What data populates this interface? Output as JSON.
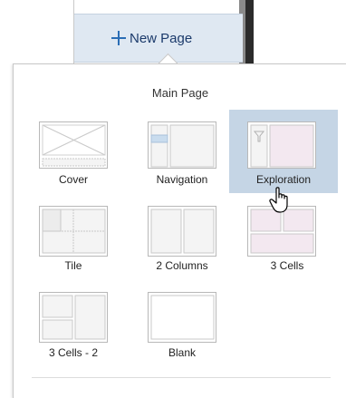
{
  "new_page": {
    "label": "New Page"
  },
  "popup": {
    "title": "Main Page",
    "layouts": [
      {
        "id": "cover",
        "label": "Cover"
      },
      {
        "id": "navigation",
        "label": "Navigation"
      },
      {
        "id": "exploration",
        "label": "Exploration",
        "selected": true
      },
      {
        "id": "tile",
        "label": "Tile"
      },
      {
        "id": "two-columns",
        "label": "2 Columns"
      },
      {
        "id": "three-cells",
        "label": "3 Cells"
      },
      {
        "id": "three-cells-2",
        "label": "3 Cells - 2"
      },
      {
        "id": "blank",
        "label": "Blank"
      }
    ]
  },
  "colors": {
    "selection": "#c5d5e5",
    "accent": "#2a6db5",
    "pink": "#f3e8f0"
  }
}
